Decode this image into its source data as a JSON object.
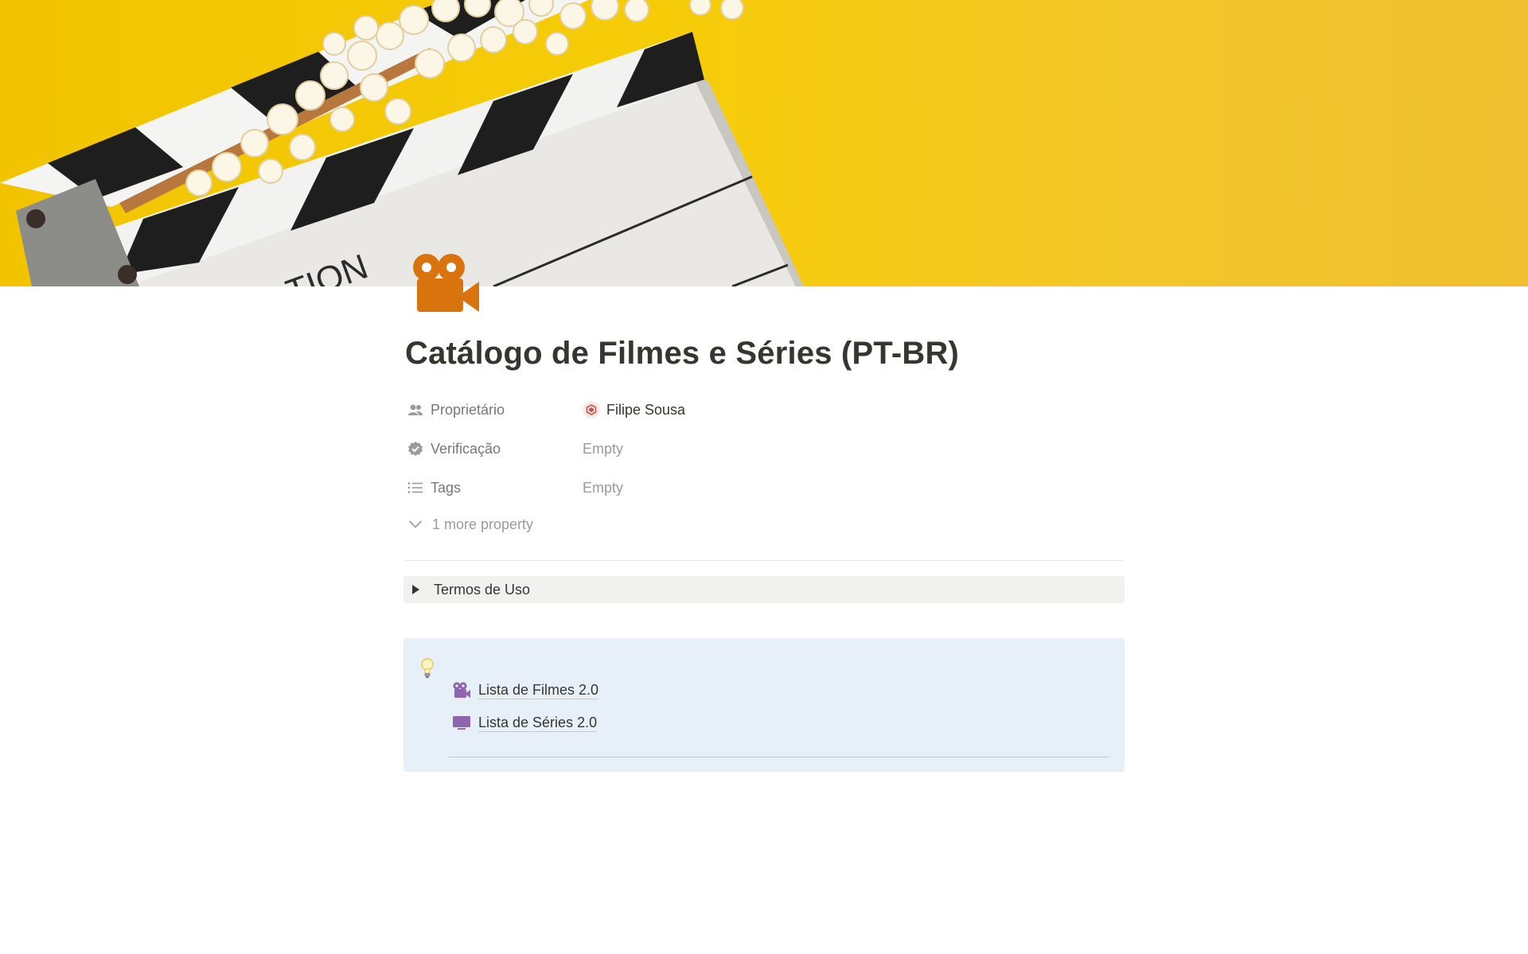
{
  "page": {
    "title": "Catálogo de Filmes e Séries (PT-BR)",
    "icon": "movie-camera-icon",
    "cover": "clapperboard-popcorn-cover"
  },
  "properties": [
    {
      "name": "Proprietário",
      "icon": "people-icon",
      "value": "Filipe Sousa",
      "value_icon": "user-avatar"
    },
    {
      "name": "Verificação",
      "icon": "verified-badge-icon",
      "value": "Empty"
    },
    {
      "name": "Tags",
      "icon": "list-icon",
      "value": "Empty"
    }
  ],
  "more_properties_label": "1 more property",
  "toggle": {
    "label": "Termos de Uso"
  },
  "callout": {
    "icon": "lightbulb-icon",
    "background": "#e7f0f8",
    "links": [
      {
        "label": "Lista de Filmes 2.0",
        "icon": "movie-camera-icon",
        "color": "#9065b0"
      },
      {
        "label": "Lista de Séries 2.0",
        "icon": "tv-icon",
        "color": "#9065b0"
      }
    ]
  },
  "colors": {
    "accent_orange": "#d9730d",
    "cover_yellow": "#f6cc08",
    "text": "#37352f",
    "muted": "#9b9a97"
  }
}
